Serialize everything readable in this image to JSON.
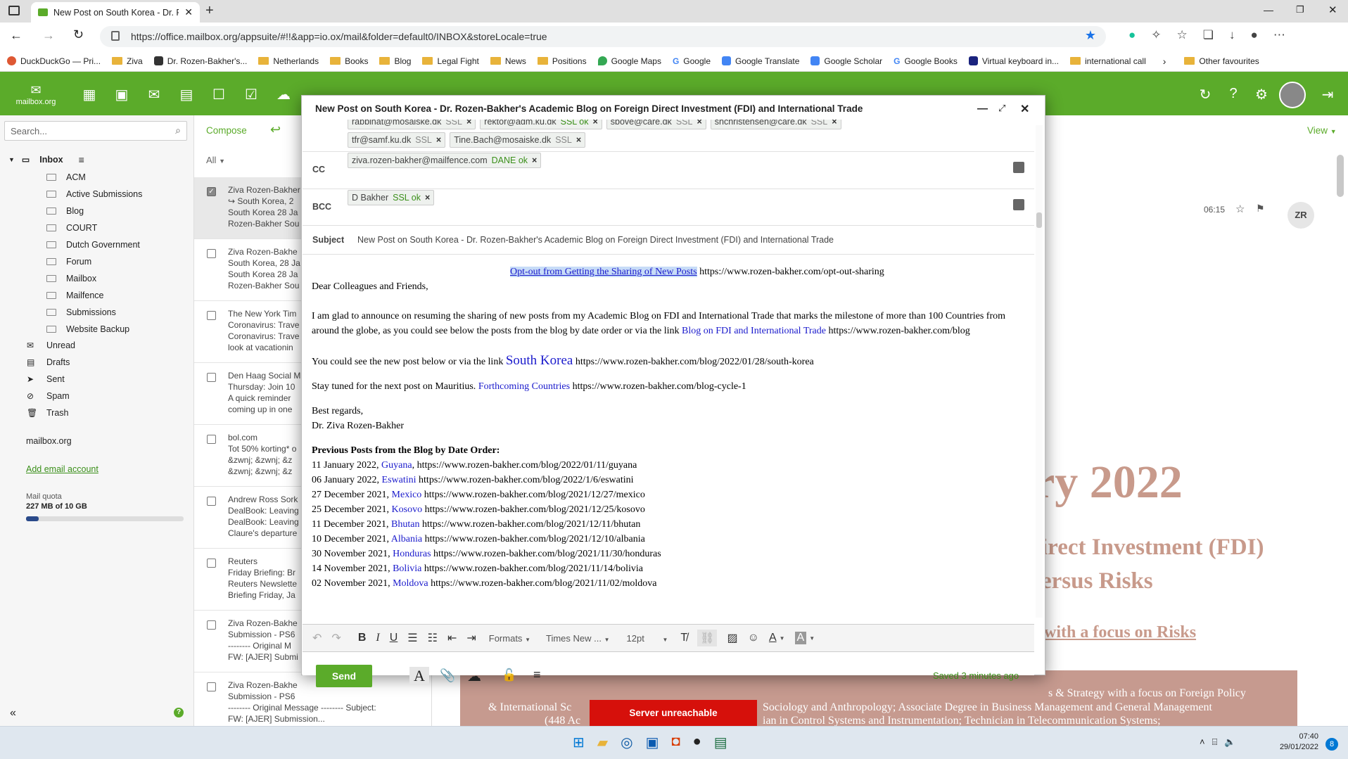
{
  "browser": {
    "tab_title": "New Post on South Korea - Dr. R",
    "url": "https://office.mailbox.org/appsuite/#!!&app=io.ox/mail&folder=default0/INBOX&storeLocale=true",
    "favorites": [
      "DuckDuckGo — Pri...",
      "Ziva",
      "Dr. Rozen-Bakher's...",
      "Netherlands",
      "Books",
      "Blog",
      "Legal Fight",
      "News",
      "Positions",
      "Google Maps",
      "Google",
      "Google Translate",
      "Google Scholar",
      "Google Books",
      "Virtual keyboard in...",
      "international call"
    ],
    "other_favourites": "Other favourites"
  },
  "app": {
    "logo_text": "mailbox.org",
    "view_label": "View",
    "avatar_initials": "ZR"
  },
  "sidebar": {
    "search_placeholder": "Search...",
    "inbox_label": "Inbox",
    "folders": [
      "ACM",
      "Active Submissions",
      "Blog",
      "COURT",
      "Dutch Government",
      "Forum",
      "Mailbox",
      "Mailfence",
      "Submissions",
      "Website Backup"
    ],
    "system_folders": [
      "Unread",
      "Drafts",
      "Sent",
      "Spam",
      "Trash"
    ],
    "account": "mailbox.org",
    "add_account": "Add email account",
    "quota_label": "Mail quota",
    "quota_value": "227 MB of 10 GB",
    "quota_fraction": 0.023
  },
  "list": {
    "compose_label": "Compose",
    "filter_label": "All",
    "rows": [
      {
        "lines": [
          "Ziva Rozen-Bakher",
          "↪ South Korea, 2",
          "South Korea 28 Ja",
          "Rozen-Bakher Sou"
        ],
        "checked": true
      },
      {
        "lines": [
          "Ziva Rozen-Bakhe",
          "South Korea, 28 Ja",
          "South Korea 28 Ja",
          "Rozen-Bakher Sou"
        ],
        "checked": false
      },
      {
        "lines": [
          "The New York Tim",
          "Coronavirus: Trave",
          "Coronavirus: Trave",
          "look at vacationin"
        ],
        "checked": false
      },
      {
        "lines": [
          "Den Haag Social M",
          "Thursday: Join 10",
          "A quick reminder",
          "coming up in one"
        ],
        "checked": false
      },
      {
        "lines": [
          "bol.com",
          "Tot 50% korting* o",
          "&zwnj; &zwnj; &z",
          "&zwnj; &zwnj; &z"
        ],
        "checked": false
      },
      {
        "lines": [
          "Andrew Ross Sork",
          "DealBook: Leaving",
          "DealBook: Leaving",
          "Claure's departure"
        ],
        "checked": false
      },
      {
        "lines": [
          "Reuters",
          "Friday Briefing: Br",
          "Reuters Newslette",
          "Briefing Friday, Ja"
        ],
        "checked": false
      },
      {
        "lines": [
          "Ziva Rozen-Bakhe",
          "Submission - PS6",
          "-------- Original M",
          "FW: [AJER] Submi"
        ],
        "checked": false
      },
      {
        "lines": [
          "Ziva Rozen-Bakhe",
          "Submission - PS6",
          "-------- Original Message -------- Subject:",
          "FW: [AJER] Submission..."
        ],
        "checked": false
      }
    ]
  },
  "reader": {
    "time": "06:15",
    "bg_title": "ry 2022",
    "bg_line1": "irect Investment (FDI)",
    "bg_line2": "ersus Risks",
    "bg_line3": "with a focus on Risks",
    "bg_band1": "s & Strategy with a focus on Foreign Policy",
    "bg_band2": "& International Sc",
    "bg_band3": "Sociology and Anthropology; Associate Degree in Business Management and General Management",
    "bg_band4": "(448 Ac",
    "bg_band5": "ian in Control Systems and Instrumentation; Technician in Telecommunication Systems;"
  },
  "compose": {
    "title": "New Post on South Korea - Dr. Rozen-Bakher's Academic Blog on Foreign Direct Investment (FDI) and International Trade",
    "to_partial": [
      {
        "addr": "rabbinat@mosaiske.dk",
        "status": "SSL"
      },
      {
        "addr": "rektor@adm.ku.dk",
        "status": "SSL ok"
      },
      {
        "addr": "sbove@care.dk",
        "status": "SSL"
      },
      {
        "addr": "snchristensen@care.dk",
        "status": "SSL"
      },
      {
        "addr": "tfr@samf.ku.dk",
        "status": "SSL"
      },
      {
        "addr": "Tine.Bach@mosaiske.dk",
        "status": "SSL"
      }
    ],
    "cc_label": "CC",
    "cc": {
      "addr": "ziva.rozen-bakher@mailfence.com",
      "status": "DANE ok"
    },
    "bcc_label": "BCC",
    "bcc": {
      "addr": "D Bakher",
      "status": "SSL ok"
    },
    "subject_label": "Subject",
    "subject": "New Post on South Korea -  Dr. Rozen-Bakher's Academic Blog on Foreign Direct Investment (FDI) and International Trade",
    "optout_link": "Opt-out from Getting the Sharing of New Posts",
    "optout_url": "https://www.rozen-bakher.com/opt-out-sharing",
    "greeting": "Dear Colleagues and Friends,",
    "para1": "I am glad to announce on resuming the sharing of new posts from my Academic Blog on FDI and International Trade that marks the milestone of more than 100 Countries from around the globe, as you could see below the posts from the blog by date order or via the link",
    "para1_link": "Blog on FDI and International Trade",
    "para1_url": "https://www.rozen-bakher.com/blog",
    "para2": "You could see the new post below or via the link",
    "para2_link": "South Korea",
    "para2_url": "https://www.rozen-bakher.com/blog/2022/01/28/south-korea",
    "para3": "Stay tuned for the next post on Mauritius.",
    "para3_link": "Forthcoming Countries",
    "para3_url": "https://www.rozen-bakher.com/blog-cycle-1",
    "regards": "Best regards,",
    "signature": "Dr. Ziva Rozen-Bakher",
    "prev_heading": "Previous Posts from the Blog by Date Order:",
    "posts": [
      {
        "date": "11 January 2022,",
        "country": "Guyana",
        "url": ", https://www.rozen-bakher.com/blog/2022/01/11/guyana"
      },
      {
        "date": "06 January 2022,",
        "country": "Eswatini",
        "url": "https://www.rozen-bakher.com/blog/2022/1/6/eswatini"
      },
      {
        "date": "27 December 2021,",
        "country": "Mexico",
        "url": "https://www.rozen-bakher.com/blog/2021/12/27/mexico"
      },
      {
        "date": "25 December 2021,",
        "country": "Kosovo",
        "url": "https://www.rozen-bakher.com/blog/2021/12/25/kosovo"
      },
      {
        "date": "11 December 2021,",
        "country": "Bhutan",
        "url": "https://www.rozen-bakher.com/blog/2021/12/11/bhutan"
      },
      {
        "date": "10 December 2021,",
        "country": "Albania",
        "url": "https://www.rozen-bakher.com/blog/2021/12/10/albania"
      },
      {
        "date": "30 November 2021,",
        "country": "Honduras",
        "url": "https://www.rozen-bakher.com/blog/2021/11/30/honduras"
      },
      {
        "date": "14 November 2021,",
        "country": "Bolivia",
        "url": "https://www.rozen-bakher.com/blog/2021/11/14/bolivia"
      },
      {
        "date": "02 November 2021,",
        "country": "Moldova",
        "url": "https://www.rozen-bakher.com/blog/2021/11/02/moldova"
      }
    ],
    "toolbar": {
      "formats": "Formats",
      "font": "Times New ...",
      "size": "12pt"
    },
    "send_label": "Send",
    "saved_status": "Saved 3 minutes ago"
  },
  "status": {
    "server": "Server unreachable"
  },
  "taskbar": {
    "time": "07:40",
    "date": "29/01/2022",
    "badge": "8"
  },
  "colors": {
    "accent": "#5bab2a",
    "link": "#1a1acc",
    "error": "#d6100b"
  }
}
